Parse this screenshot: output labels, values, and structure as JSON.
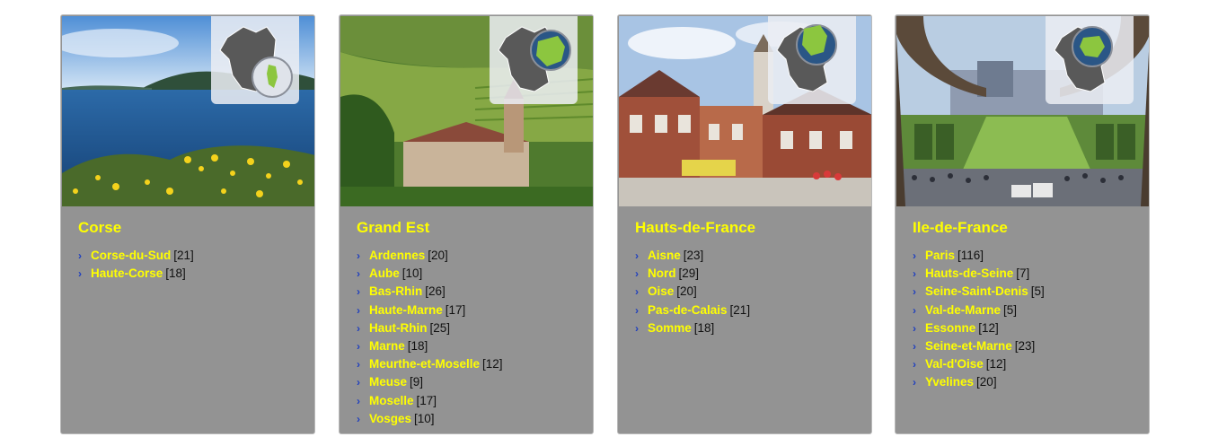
{
  "regions": [
    {
      "name": "Corse",
      "departments": [
        {
          "name": "Corse-du-Sud",
          "count": "[21]"
        },
        {
          "name": "Haute-Corse",
          "count": "[18]"
        }
      ]
    },
    {
      "name": "Grand Est",
      "departments": [
        {
          "name": "Ardennes",
          "count": "[20]"
        },
        {
          "name": "Aube",
          "count": "[10]"
        },
        {
          "name": "Bas-Rhin",
          "count": "[26]"
        },
        {
          "name": "Haute-Marne",
          "count": "[17]"
        },
        {
          "name": "Haut-Rhin",
          "count": "[25]"
        },
        {
          "name": "Marne",
          "count": "[18]"
        },
        {
          "name": "Meurthe-et-Moselle",
          "count": "[12]"
        },
        {
          "name": "Meuse",
          "count": "[9]"
        },
        {
          "name": "Moselle",
          "count": "[17]"
        },
        {
          "name": "Vosges",
          "count": "[10]"
        }
      ]
    },
    {
      "name": "Hauts-de-France",
      "departments": [
        {
          "name": "Aisne",
          "count": "[23]"
        },
        {
          "name": "Nord",
          "count": "[29]"
        },
        {
          "name": "Oise",
          "count": "[20]"
        },
        {
          "name": "Pas-de-Calais",
          "count": "[21]"
        },
        {
          "name": "Somme",
          "count": "[18]"
        }
      ]
    },
    {
      "name": "Ile-de-France",
      "departments": [
        {
          "name": "Paris",
          "count": "[116]"
        },
        {
          "name": "Hauts-de-Seine",
          "count": "[7]"
        },
        {
          "name": "Seine-Saint-Denis",
          "count": "[5]"
        },
        {
          "name": "Val-de-Marne",
          "count": "[5]"
        },
        {
          "name": "Essonne",
          "count": "[12]"
        },
        {
          "name": "Seine-et-Marne",
          "count": "[23]"
        },
        {
          "name": "Val-d'Oise",
          "count": "[12]"
        },
        {
          "name": "Yvelines",
          "count": "[20]"
        }
      ]
    }
  ],
  "colors": {
    "card_bg": "#939393",
    "title_color": "#ffff00",
    "link_color": "#ffff00",
    "bullet_color": "#1f3fbf",
    "map_gray": "#595959",
    "map_highlight": "#8cc63f",
    "globe_blue": "#2a5686"
  },
  "icons": {
    "bullet": "chevron-right-icon",
    "map": "france-map-icon"
  }
}
